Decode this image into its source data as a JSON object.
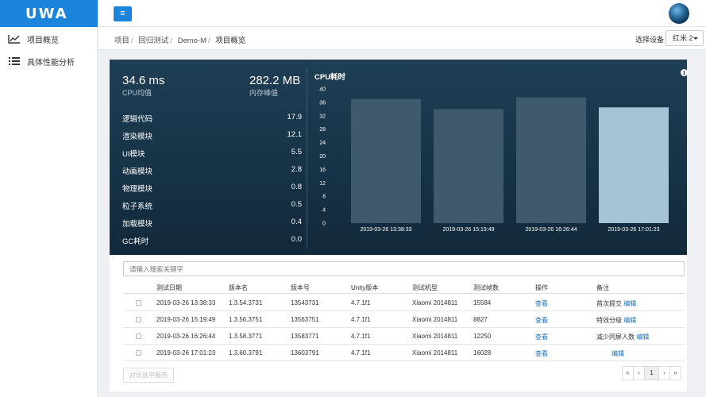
{
  "app": {
    "logo": "UWA",
    "menu_icon": "menu-icon"
  },
  "sidebar": {
    "items": [
      {
        "label": "项目概览",
        "icon": "line-chart-icon"
      },
      {
        "label": "具体性能分析",
        "icon": "list-icon"
      }
    ]
  },
  "breadcrumb": [
    "项目",
    "回归测试",
    "Demo-M",
    "项目概览"
  ],
  "device": {
    "label": "选择设备",
    "selected": "红米 2"
  },
  "summary": {
    "cpu_value": "34.6 ms",
    "cpu_label": "CPU均值",
    "mem_value": "282.2 MB",
    "mem_label": "内存峰值"
  },
  "modules": [
    {
      "name": "逻辑代码",
      "value": "17.9"
    },
    {
      "name": "渲染模块",
      "value": "12.1"
    },
    {
      "name": "UI模块",
      "value": "5.5"
    },
    {
      "name": "动画模块",
      "value": "2.8"
    },
    {
      "name": "物理模块",
      "value": "0.8"
    },
    {
      "name": "粒子系统",
      "value": "0.5"
    },
    {
      "name": "加载模块",
      "value": "0.4"
    },
    {
      "name": "GC耗时",
      "value": "0.0"
    }
  ],
  "chart_data": {
    "type": "bar",
    "title": "CPU耗时",
    "categories": [
      "2019-03-26 13:38:33",
      "2019-03-26 15:19:49",
      "2019-03-26 16:26:44",
      "2019-03-26 17:01:23"
    ],
    "values": [
      37,
      34,
      37.5,
      34.5
    ],
    "ylim": [
      0,
      40
    ],
    "yticks": [
      0,
      4,
      8,
      12,
      16,
      20,
      24,
      28,
      32,
      36,
      40
    ],
    "colors": [
      "#3f5a6d",
      "#3f5a6d",
      "#3f5a6d",
      "#a7c3d6"
    ],
    "grid": false
  },
  "table": {
    "search_placeholder": "请输入搜索关键字",
    "headers": [
      "测试日期",
      "版本名",
      "版本号",
      "Unity版本",
      "测试机型",
      "测试帧数",
      "操作",
      "备注"
    ],
    "rows": [
      {
        "date": "2019-03-26 13:38:33",
        "ver_name": "1.3.54.3731",
        "ver_code": "13543731",
        "unity": "4.7.1f1",
        "device": "Xiaomi 2014811",
        "frames": "15584",
        "action": "查看",
        "note": "首次提交",
        "edit": "编辑"
      },
      {
        "date": "2019-03-26 15:19:49",
        "ver_name": "1.3.56.3751",
        "ver_code": "13563751",
        "unity": "4.7.1f1",
        "device": "Xiaomi 2014811",
        "frames": "8827",
        "action": "查看",
        "note": "特效分级",
        "edit": "编辑"
      },
      {
        "date": "2019-03-26 16:26:44",
        "ver_name": "1.3.58.3771",
        "ver_code": "13583771",
        "unity": "4.7.1f1",
        "device": "Xiaomi 2014811",
        "frames": "12250",
        "action": "查看",
        "note": "减少同屏人数",
        "edit": "编辑"
      },
      {
        "date": "2019-03-26 17:01:23",
        "ver_name": "1.3.60.3791",
        "ver_code": "13603791",
        "unity": "4.7.1f1",
        "device": "Xiaomi 2014811",
        "frames": "16028",
        "action": "查看",
        "note": "",
        "edit": "编辑"
      }
    ],
    "compare_button": "对比选中报告"
  },
  "pagination": {
    "first": "«",
    "prev": "‹",
    "current": "1",
    "next": "›",
    "last": "»"
  }
}
